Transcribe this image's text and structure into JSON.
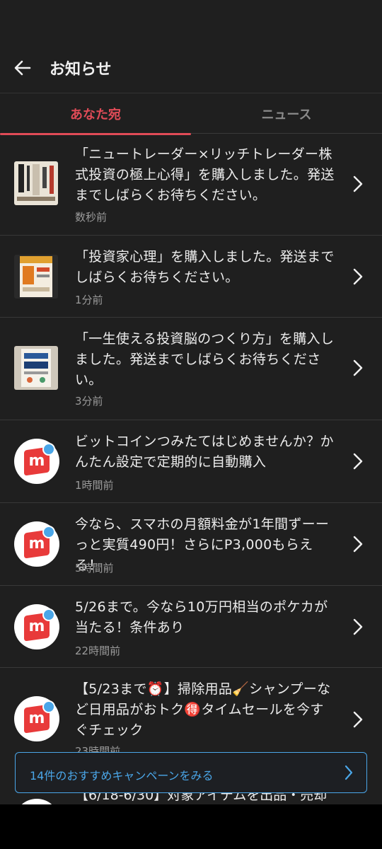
{
  "header": {
    "title": "お知らせ",
    "back_icon": "arrow-left-icon"
  },
  "tabs": [
    {
      "label": "あなた宛",
      "active": true
    },
    {
      "label": "ニュース",
      "active": false
    }
  ],
  "notifications": [
    {
      "text": "「ニュートレーダー×リッチトレーダー株式投資の極上心得」を購入しました。発送までしばらくお待ちください。",
      "time": "数秒前",
      "thumb": "book-cover-1"
    },
    {
      "text": "「投資家心理」を購入しました。発送までしばらくお待ちください。",
      "time": "1分前",
      "thumb": "book-cover-2"
    },
    {
      "text": "「一生使える投資脳のつくり方」を購入しました。発送までしばらくお待ちください。",
      "time": "3分前",
      "thumb": "book-cover-3"
    },
    {
      "text": "ビットコインつみたてはじめませんか？かんたん設定で定期的に自動購入",
      "time": "1時間前",
      "thumb": "mercari-logo"
    },
    {
      "text": "今なら、スマホの月額料金が1年間ずーーっと実質490円！さらにP3,000もらえる！",
      "time": "5時間前",
      "thumb": "mercari-logo"
    },
    {
      "text": "5/26まで。今なら10万円相当のポケカが当たる！条件あり",
      "time": "22時間前",
      "thumb": "mercari-logo"
    },
    {
      "text": "【5/23まで⏰】掃除用品🧹シャンプーなど日用品がおトク🉐タイムセールを今すぐチェック",
      "time": "23時間前",
      "thumb": "mercari-logo"
    }
  ],
  "banner": {
    "label": "14件のおすすめキャンペーンをみる"
  },
  "peek_text": "【6/18-6/30】対象アイテムを出品・売却",
  "colors": {
    "accent": "#e04b57",
    "link": "#4aa6e8",
    "background": "#1f1f1f"
  }
}
